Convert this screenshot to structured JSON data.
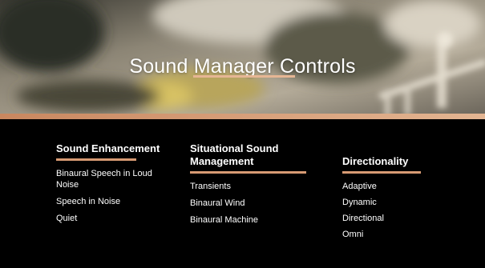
{
  "slide": {
    "title": "Sound Manager Controls",
    "columns": [
      {
        "heading": "Sound Enhancement",
        "items": [
          "Binaural Speech in Loud Noise",
          "Speech in Noise",
          "Quiet"
        ]
      },
      {
        "heading": "Situational Sound Management",
        "items": [
          "Transients",
          "Binaural Wind",
          "Binaural Machine"
        ]
      },
      {
        "heading": "Directionality",
        "items": [
          "Adaptive",
          "Dynamic",
          "Directional",
          "Omni"
        ]
      }
    ]
  },
  "colors": {
    "background": "#000000",
    "accent": "#d79a73",
    "text": "#ffffff"
  }
}
